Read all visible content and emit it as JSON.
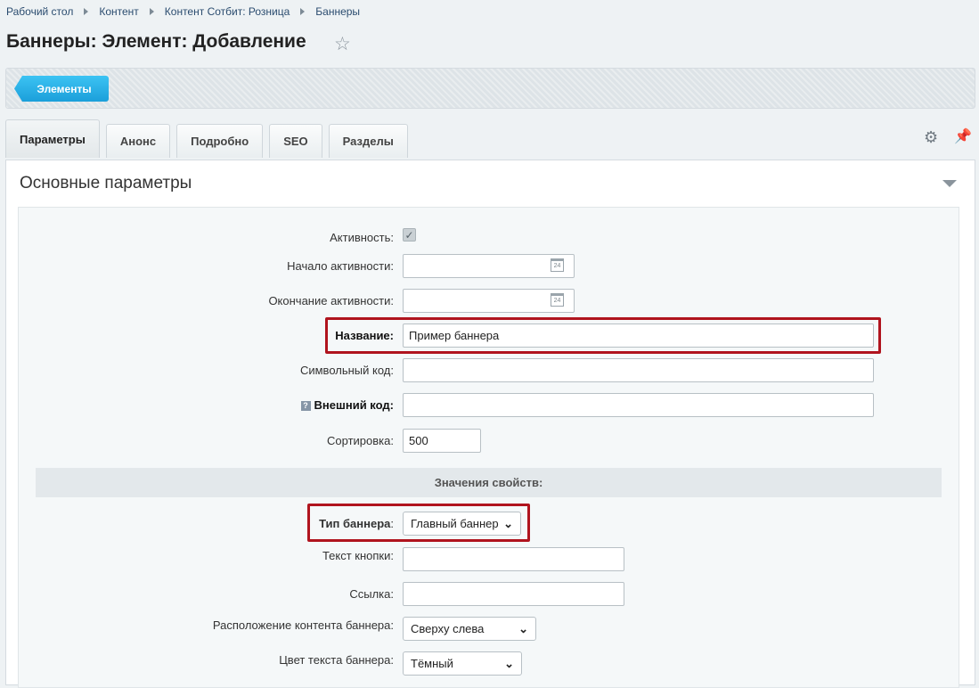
{
  "breadcrumbs": [
    "Рабочий стол",
    "Контент",
    "Контент Сотбит: Розница",
    "Баннеры"
  ],
  "page": {
    "title": "Баннеры: Элемент: Добавление"
  },
  "toolbar": {
    "back_label": "Элементы"
  },
  "tabs": [
    {
      "label": "Параметры",
      "active": true
    },
    {
      "label": "Анонс"
    },
    {
      "label": "Подробно"
    },
    {
      "label": "SEO"
    },
    {
      "label": "Разделы"
    }
  ],
  "section": {
    "title": "Основные параметры"
  },
  "form": {
    "active_label": "Активность:",
    "active_checked": true,
    "start_label": "Начало активности:",
    "start_value": "",
    "end_label": "Окончание активности:",
    "end_value": "",
    "calendar_day": "24",
    "name_label": "Название:",
    "name_value": "Пример баннера",
    "code_label": "Символьный код:",
    "code_value": "",
    "help_glyph": "?",
    "xml_label": "Внешний код:",
    "xml_value": "",
    "sort_label": "Сортировка:",
    "sort_value": "500"
  },
  "props": {
    "header": "Значения свойств:",
    "type_label": "Тип баннера",
    "type_colon": ":",
    "type_value": "Главный баннер",
    "button_text_label": "Текст кнопки:",
    "button_text_value": "",
    "link_label": "Ссылка:",
    "link_value": "",
    "position_label": "Расположение контента баннера:",
    "position_value": "Сверху слева",
    "color_label": "Цвет текста баннера:",
    "color_value": "Тёмный"
  },
  "colors": {
    "accent": "#1b9fda",
    "highlight": "#b0141e"
  }
}
